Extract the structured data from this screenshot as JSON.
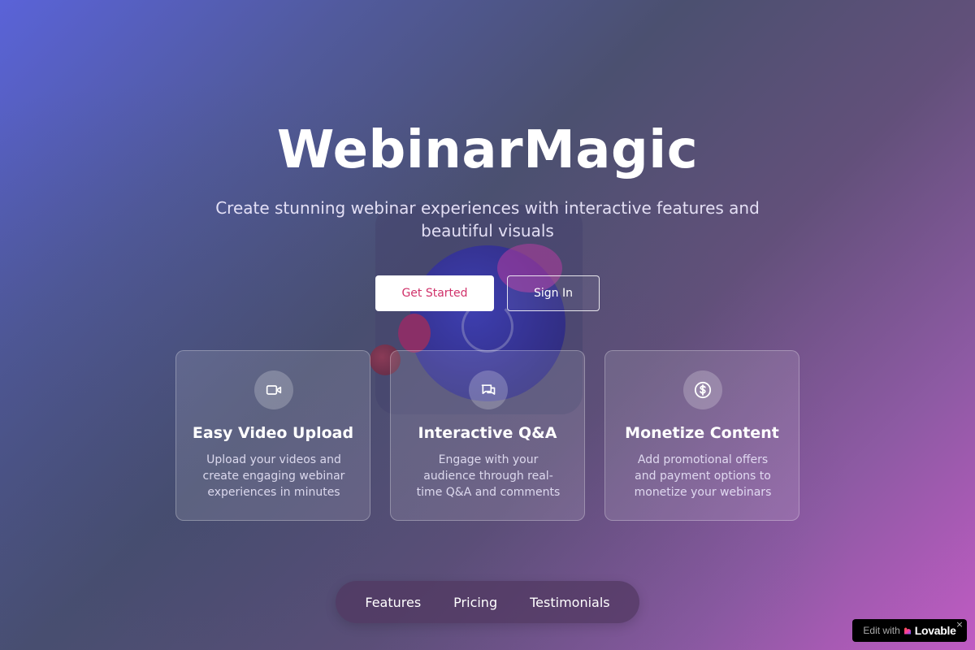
{
  "hero": {
    "title": "WebinarMagic",
    "subtitle": "Create stunning webinar experiences with interactive features and beautiful visuals"
  },
  "buttons": {
    "primary_label": "Get Started",
    "secondary_label": "Sign In"
  },
  "features": [
    {
      "icon": "video-icon",
      "title": "Easy Video Upload",
      "description": "Upload your videos and create engaging webinar experiences in minutes"
    },
    {
      "icon": "chat-icon",
      "title": "Interactive Q&A",
      "description": "Engage with your audience through real-time Q&A and comments"
    },
    {
      "icon": "dollar-icon",
      "title": "Monetize Content",
      "description": "Add promotional offers and payment options to monetize your webinars"
    }
  ],
  "nav": {
    "items": [
      "Features",
      "Pricing",
      "Testimonials"
    ]
  },
  "badge": {
    "prefix": "Edit with",
    "brand": "Lovable",
    "close": "×"
  },
  "colors": {
    "primary_button_text": "#d0316a",
    "gradient_start": "#5a63d8",
    "gradient_end": "#c05bc3"
  }
}
